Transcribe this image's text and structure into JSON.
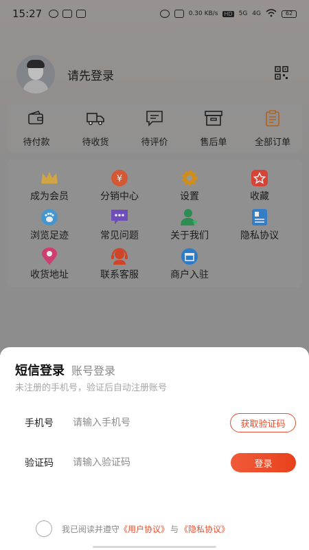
{
  "status": {
    "time": "15:27",
    "net_speed": "0.30 KB/s",
    "hd": "HD",
    "sig1": "5G",
    "sig2": "4G",
    "battery": "62"
  },
  "profile": {
    "login_prompt": "请先登录"
  },
  "orders": [
    {
      "label": "待付款",
      "icon": "wallet-icon"
    },
    {
      "label": "待收货",
      "icon": "truck-icon"
    },
    {
      "label": "待评价",
      "icon": "comment-icon"
    },
    {
      "label": "售后单",
      "icon": "box-icon"
    },
    {
      "label": "全部订单",
      "icon": "clipboard-icon"
    }
  ],
  "services": [
    {
      "label": "成为会员",
      "icon": "crown-icon",
      "color": "#e3b24a"
    },
    {
      "label": "分销中心",
      "icon": "coin-hand-icon",
      "color": "#e8603a"
    },
    {
      "label": "设置",
      "icon": "gear-icon",
      "color": "#e39a1c"
    },
    {
      "label": "收藏",
      "icon": "star-icon",
      "color": "#e84a3c"
    },
    {
      "label": "浏览足迹",
      "icon": "footprint-icon",
      "color": "#4ba3e0"
    },
    {
      "label": "常见问题",
      "icon": "chat-icon",
      "color": "#7a55c9"
    },
    {
      "label": "关于我们",
      "icon": "user-star-icon",
      "color": "#2f9a5a"
    },
    {
      "label": "隐私协议",
      "icon": "doc-icon",
      "color": "#3a88d6"
    },
    {
      "label": "收货地址",
      "icon": "location-icon",
      "color": "#e0447a"
    },
    {
      "label": "联系客服",
      "icon": "headset-icon",
      "color": "#e04b2c"
    },
    {
      "label": "商户入驻",
      "icon": "store-icon",
      "color": "#2f86d8"
    }
  ],
  "login": {
    "tab_sms": "短信登录",
    "tab_account": "账号登录",
    "hint": "未注册的手机号，验证后自动注册账号",
    "phone_label": "手机号",
    "phone_placeholder": "请输入手机号",
    "get_code": "获取验证码",
    "code_label": "验证码",
    "code_placeholder": "请输入验证码",
    "login_button": "登录",
    "agree_text": "我已阅读并遵守",
    "user_agreement": "《用户协议》",
    "and": "与",
    "privacy_agreement": "《隐私协议》"
  },
  "colors": {
    "accent": "#e0502f"
  }
}
